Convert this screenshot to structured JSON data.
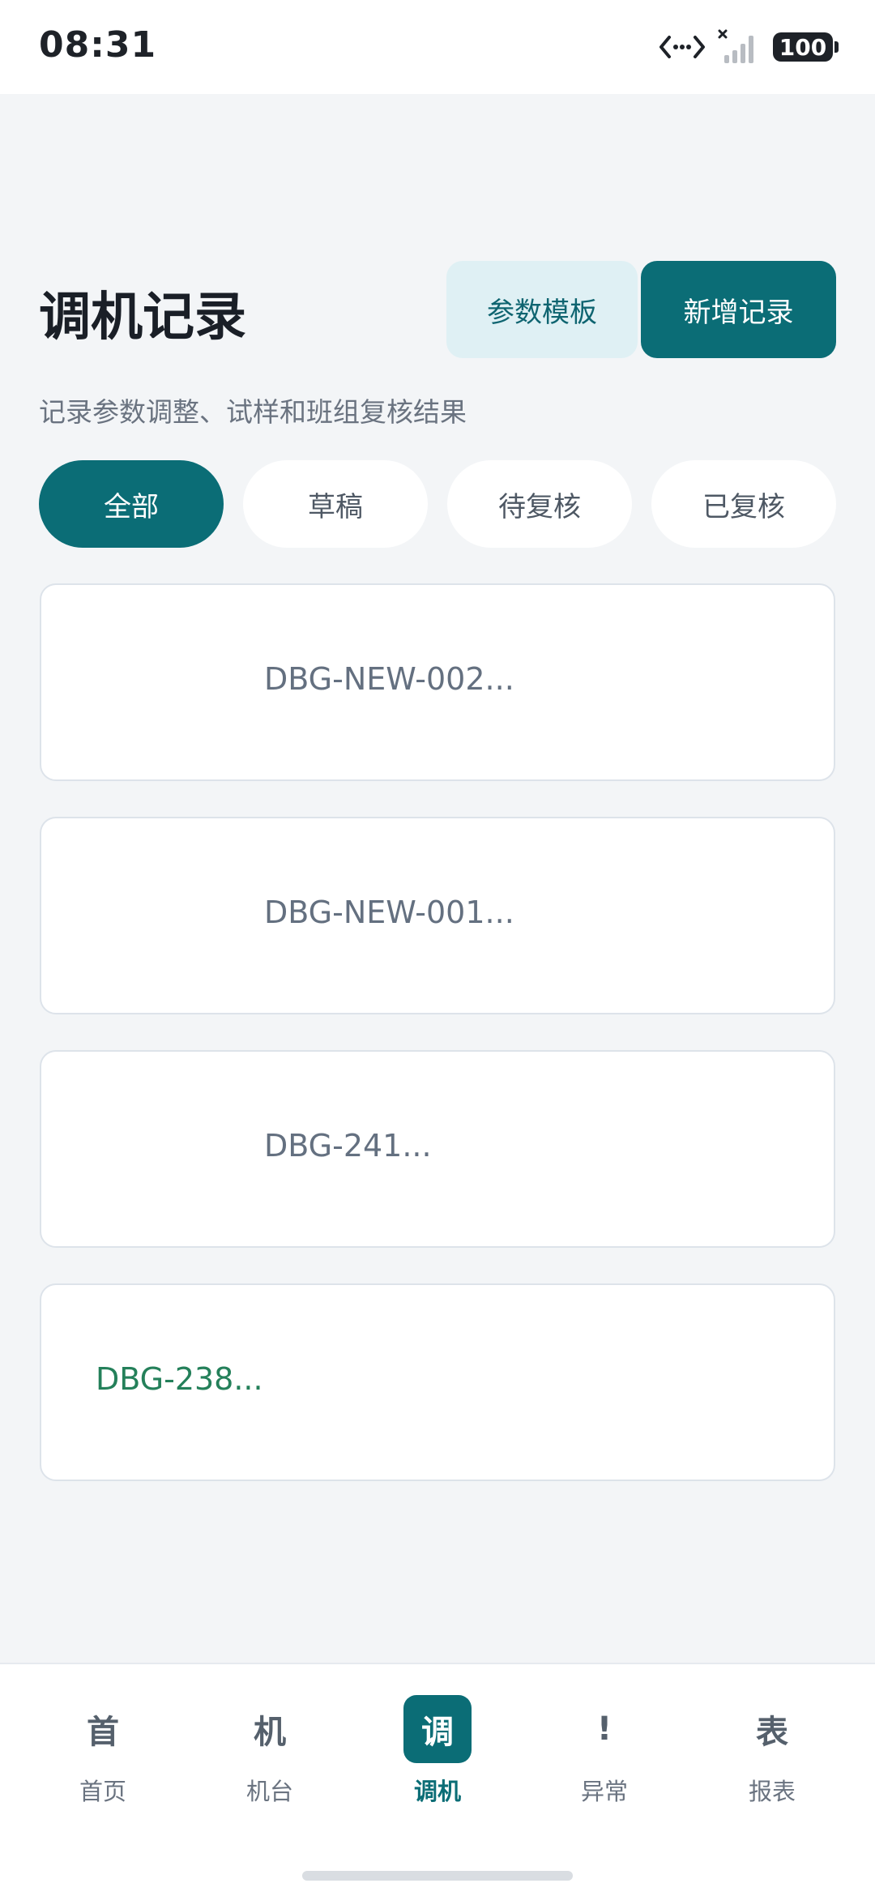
{
  "status_bar": {
    "time": "08:31",
    "battery": "100",
    "icons": [
      "data-transfer-icon",
      "no-signal-icon",
      "battery-icon"
    ]
  },
  "header": {
    "title": "调机记录",
    "subtitle": "记录参数调整、试样和班组复核结果",
    "template_button": "参数模板",
    "new_button": "新增记录"
  },
  "filters": {
    "tabs": [
      "全部",
      "草稿",
      "待复核",
      "已复核"
    ],
    "active": "全部"
  },
  "records": [
    {
      "id": "DBG-NEW-002..."
    },
    {
      "id": "DBG-NEW-001..."
    },
    {
      "id": "DBG-241..."
    },
    {
      "id": "DBG-238..."
    }
  ],
  "bottom_nav": {
    "items": [
      {
        "glyph": "首",
        "label": "首页"
      },
      {
        "glyph": "机",
        "label": "机台"
      },
      {
        "glyph": "调",
        "label": "调机"
      },
      {
        "glyph": "!",
        "label": "异常"
      },
      {
        "glyph": "表",
        "label": "报表"
      }
    ],
    "active": "调机"
  },
  "colors": {
    "accent": "#0b6d76",
    "accent_light": "#dff0f4",
    "background": "#f3f5f7",
    "success_text": "#24805a"
  }
}
